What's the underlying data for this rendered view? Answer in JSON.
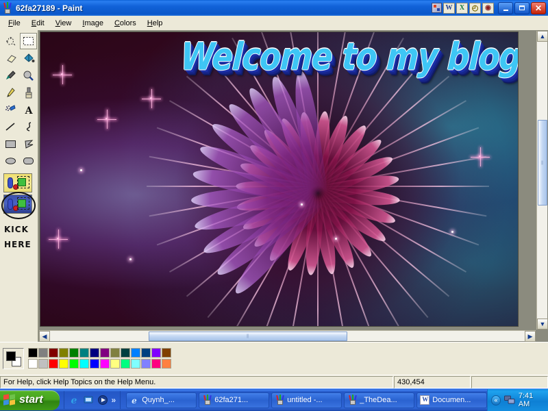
{
  "window": {
    "title": "62fa27189 - Paint",
    "icon": "paint-icon",
    "minimize_label": "Minimize",
    "maximize_label": "Maximize",
    "close_label": "Close"
  },
  "office_bar": {
    "grip": "office-shortcut-grip",
    "buttons": [
      {
        "name": "word-icon",
        "glyph": "W",
        "class": "ob-w"
      },
      {
        "name": "excel-icon",
        "glyph": "X",
        "class": "ob-x"
      },
      {
        "name": "clock-icon",
        "glyph": "◴",
        "class": "ob-clock"
      },
      {
        "name": "media-icon",
        "glyph": "◉",
        "class": "ob-misc"
      }
    ]
  },
  "menu": [
    {
      "name": "menu-file",
      "accel": "F",
      "rest": "ile"
    },
    {
      "name": "menu-edit",
      "accel": "E",
      "rest": "dit"
    },
    {
      "name": "menu-view",
      "accel": "V",
      "rest": "iew"
    },
    {
      "name": "menu-image",
      "accel": "I",
      "rest": "mage"
    },
    {
      "name": "menu-colors",
      "accel": "C",
      "rest": "olors"
    },
    {
      "name": "menu-help",
      "accel": "H",
      "rest": "elp"
    }
  ],
  "toolbox": {
    "tools": [
      {
        "name": "free-form-select-tool",
        "label": "Free-Form Select",
        "selected": false
      },
      {
        "name": "rectangle-select-tool",
        "label": "Select",
        "selected": true
      },
      {
        "name": "eraser-tool",
        "label": "Eraser/Color Eraser",
        "selected": false
      },
      {
        "name": "fill-tool",
        "label": "Fill With Color",
        "selected": false
      },
      {
        "name": "color-picker-tool",
        "label": "Pick Color",
        "selected": false
      },
      {
        "name": "magnifier-tool",
        "label": "Magnifier",
        "selected": false
      },
      {
        "name": "pencil-tool",
        "label": "Pencil",
        "selected": false
      },
      {
        "name": "brush-tool",
        "label": "Brush",
        "selected": false
      },
      {
        "name": "airbrush-tool",
        "label": "Airbrush",
        "selected": false
      },
      {
        "name": "text-tool",
        "label": "Text",
        "selected": false
      },
      {
        "name": "line-tool",
        "label": "Line",
        "selected": false
      },
      {
        "name": "curve-tool",
        "label": "Curve",
        "selected": false
      },
      {
        "name": "rectangle-tool",
        "label": "Rectangle",
        "selected": false
      },
      {
        "name": "polygon-tool",
        "label": "Polygon",
        "selected": false
      },
      {
        "name": "ellipse-tool",
        "label": "Ellipse",
        "selected": false
      },
      {
        "name": "rounded-rectangle-tool",
        "label": "Rounded Rectangle",
        "selected": false
      }
    ],
    "annotation": {
      "line1": "KICK",
      "line2": "HERE"
    }
  },
  "canvas": {
    "welcome_text": "Welcome to my blog",
    "welcome_color": "#3ec6f5",
    "welcome_shadow_color": "#1b2fa8",
    "background_colors": [
      "#55103a",
      "#420c2c",
      "#32081f"
    ]
  },
  "scrollbars": {
    "up_glyph": "▲",
    "down_glyph": "▼",
    "left_glyph": "◀",
    "right_glyph": "▶",
    "grip_glyph": "‖"
  },
  "palette": {
    "foreground": "#000000",
    "background": "#ffffff",
    "colors_top": [
      "#000000",
      "#808080",
      "#800000",
      "#808000",
      "#008000",
      "#008080",
      "#000080",
      "#800080",
      "#808040",
      "#004040",
      "#0080ff",
      "#004080",
      "#8000ff",
      "#804000"
    ],
    "colors_bottom": [
      "#ffffff",
      "#c0c0c0",
      "#ff0000",
      "#ffff00",
      "#00ff00",
      "#00ffff",
      "#0000ff",
      "#ff00ff",
      "#ffff80",
      "#00ff80",
      "#80ffff",
      "#8080ff",
      "#ff0080",
      "#ff8040"
    ]
  },
  "statusbar": {
    "help_text": "For Help, click Help Topics on the Help Menu.",
    "coordinates": "430,454",
    "extra": ""
  },
  "taskbar": {
    "start_label": "start",
    "quick_launch": [
      {
        "name": "internet-explorer-icon",
        "glyph": "e"
      },
      {
        "name": "show-desktop-icon",
        "glyph": "▣"
      },
      {
        "name": "media-player-icon",
        "glyph": "▶"
      }
    ],
    "quick_launch_chevron": "»",
    "tasks": [
      {
        "name": "taskbar-item-quynh",
        "label": "Quynh_...",
        "icon": "ie-icon"
      },
      {
        "name": "taskbar-item-62fa271",
        "label": "62fa271...",
        "icon": "paint-icon"
      },
      {
        "name": "taskbar-item-untitled",
        "label": "untitled -...",
        "icon": "paint-icon"
      },
      {
        "name": "taskbar-item-thedea",
        "label": "_TheDea...",
        "icon": "paint-icon"
      },
      {
        "name": "taskbar-item-document",
        "label": "Documen...",
        "icon": "word-icon"
      }
    ],
    "tray": {
      "expand_glyph": "«",
      "network_icon": "network-icon",
      "clock": "7:41 AM"
    }
  }
}
